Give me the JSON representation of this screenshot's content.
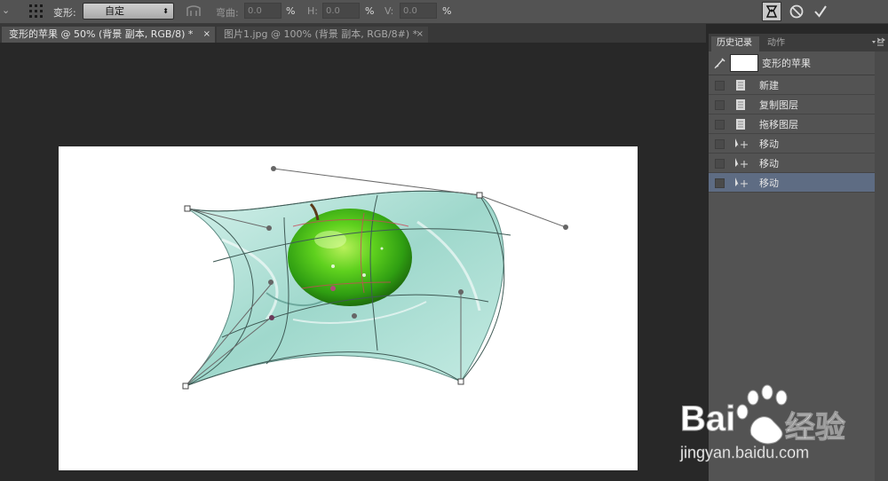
{
  "options_bar": {
    "transform_label": "变形:",
    "warp_style": "自定",
    "bend_label": "弯曲:",
    "bend_value": "0.0",
    "bend_unit": "%",
    "h_label": "H:",
    "h_value": "0.0",
    "h_unit": "%",
    "v_label": "V:",
    "v_value": "0.0",
    "v_unit": "%"
  },
  "tabs": [
    {
      "label": "变形的苹果 @ 50% (背景 副本, RGB/8) *",
      "close": "×"
    },
    {
      "label": "图片1.jpg @ 100% (背景 副本, RGB/8#) *",
      "close": "×"
    }
  ],
  "panel": {
    "tabs": [
      "历史记录",
      "动作"
    ],
    "menu_icon": "panel-menu-icon",
    "snapshot_name": "变形的苹果",
    "history": [
      {
        "label": "新建",
        "icon": "document-icon"
      },
      {
        "label": "复制图层",
        "icon": "document-icon"
      },
      {
        "label": "拖移图层",
        "icon": "document-icon"
      },
      {
        "label": "移动",
        "icon": "move-tool-icon"
      },
      {
        "label": "移动",
        "icon": "move-tool-icon"
      },
      {
        "label": "移动",
        "icon": "move-tool-icon",
        "selected": true
      }
    ]
  },
  "watermark": {
    "brand": "Bai",
    "brand2": "经验",
    "url": "jingyan.baidu.com"
  },
  "colors": {
    "selection": "#5e6c83",
    "warp_line": "#3f5a55",
    "handle": "#666666"
  }
}
